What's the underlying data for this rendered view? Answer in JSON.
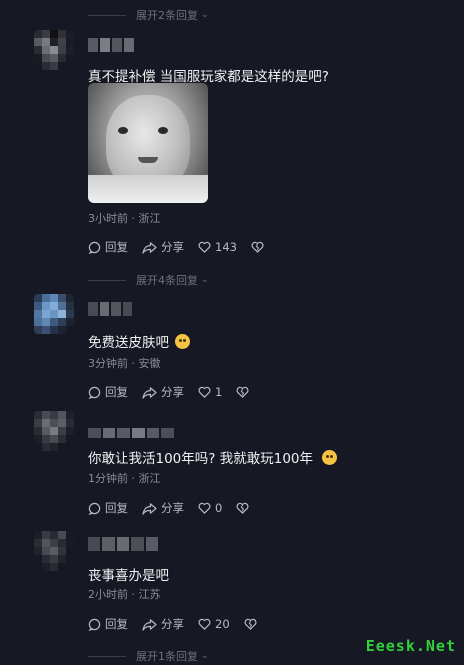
{
  "expand_rows": [
    {
      "label": "展开2条回复"
    },
    {
      "label": "展开4条回复"
    },
    {
      "label": "展开1条回复"
    }
  ],
  "comments": [
    {
      "text": "真不提补偿 当国服玩家都是这样的是吧?",
      "time_location": "3小时前 · 浙江",
      "reply_label": "回复",
      "share_label": "分享",
      "likes": "143",
      "has_image": true
    },
    {
      "text": "免费送皮肤吧",
      "emoji": "thinking-emoji",
      "time_location": "3分钟前 · 安徽",
      "reply_label": "回复",
      "share_label": "分享",
      "likes": "1"
    },
    {
      "text": "你敢让我活100年吗? 我就敢玩100年",
      "emoji": "grin-emoji",
      "time_location": "1分钟前 · 浙江",
      "reply_label": "回复",
      "share_label": "分享",
      "likes": "0"
    },
    {
      "text": "丧事喜办是吧",
      "time_location": "2小时前 · 江苏",
      "reply_label": "回复",
      "share_label": "分享",
      "likes": "20"
    }
  ],
  "watermark": "Eeesk.Net",
  "colors": {
    "background": "#161823",
    "text": "#f0f0f2",
    "meta": "#8a8c95",
    "watermark": "#2fd23a"
  }
}
